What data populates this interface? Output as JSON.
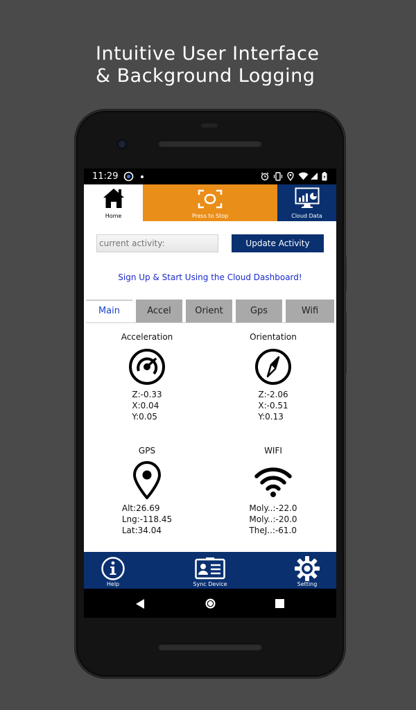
{
  "headline": {
    "line1": "Intuitive User Interface",
    "line2": "& Background Logging"
  },
  "statusbar": {
    "time": "11:29"
  },
  "appbar": {
    "home_label": "Home",
    "stop_label": "Press to Stop",
    "cloud_label": "Cloud Data"
  },
  "activity": {
    "placeholder": "current activity:",
    "button_label": "Update Activity"
  },
  "signup_link": "Sign Up & Start Using the Cloud Dashboard!",
  "tabs": [
    {
      "label": "Main",
      "active": true
    },
    {
      "label": "Accel",
      "active": false
    },
    {
      "label": "Orient",
      "active": false
    },
    {
      "label": "Gps",
      "active": false
    },
    {
      "label": "Wifi",
      "active": false
    }
  ],
  "sensors": {
    "acceleration": {
      "title": "Acceleration",
      "icon": "gauge-icon",
      "values": [
        "Z:-0.33",
        "X:0.04",
        "Y:0.05"
      ]
    },
    "orientation": {
      "title": "Orientation",
      "icon": "compass-icon",
      "values": [
        "Z:-2.06",
        "X:-0.51",
        "Y:0.13"
      ]
    },
    "gps": {
      "title": "GPS",
      "icon": "location-pin-icon",
      "values": [
        "Alt:26.69",
        "Lng:-118.45",
        "Lat:34.04"
      ]
    },
    "wifi": {
      "title": "WIFI",
      "icon": "wifi-icon",
      "values": [
        "Moly..:-22.0",
        "Moly..:-20.0",
        "TheJ..:-61.0"
      ]
    }
  },
  "bottombar": {
    "help_label": "Help",
    "sync_label": "Sync Device",
    "setting_label": "Setting"
  },
  "colors": {
    "background": "#4a4a4a",
    "navy": "#0a3070",
    "orange": "#ea8e1a",
    "link": "#1a29c9",
    "tab_inactive": "#a9a9a9"
  }
}
